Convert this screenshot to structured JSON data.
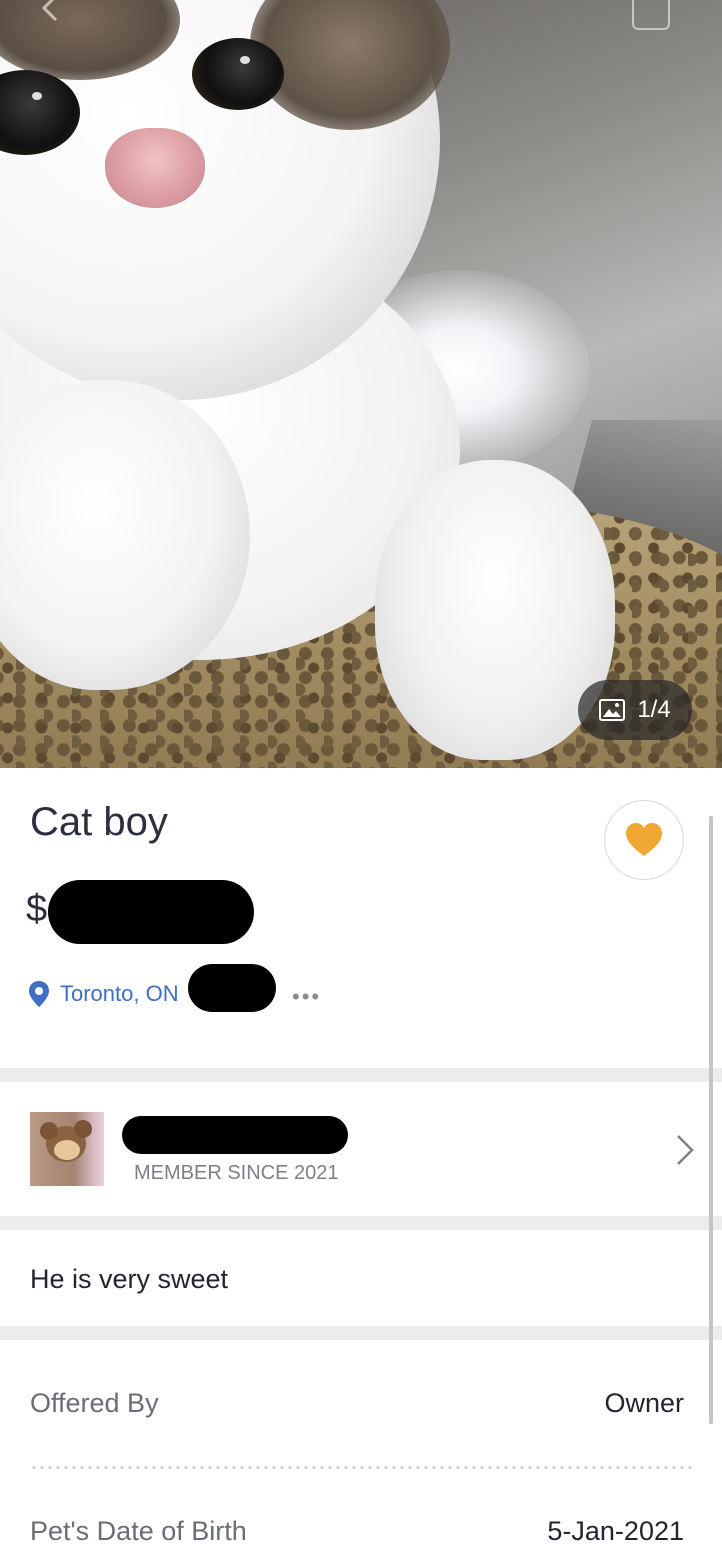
{
  "photo": {
    "counter_text": "1/4",
    "counter_icon": "image-icon"
  },
  "listing": {
    "title": "Cat boy",
    "price_prefix": "$",
    "location": "Toronto, ON",
    "more": "•••",
    "favorite_icon": "heart-icon",
    "favorite_color": "#f0a833"
  },
  "seller": {
    "member_since": "MEMBER SINCE 2021"
  },
  "description": "He is very sweet",
  "details": [
    {
      "key": "Offered By",
      "value": "Owner"
    },
    {
      "key": "Pet's Date of Birth",
      "value": "5-Jan-2021"
    }
  ],
  "colors": {
    "location_blue": "#3d6fc4",
    "divider_gray": "#ececef"
  }
}
